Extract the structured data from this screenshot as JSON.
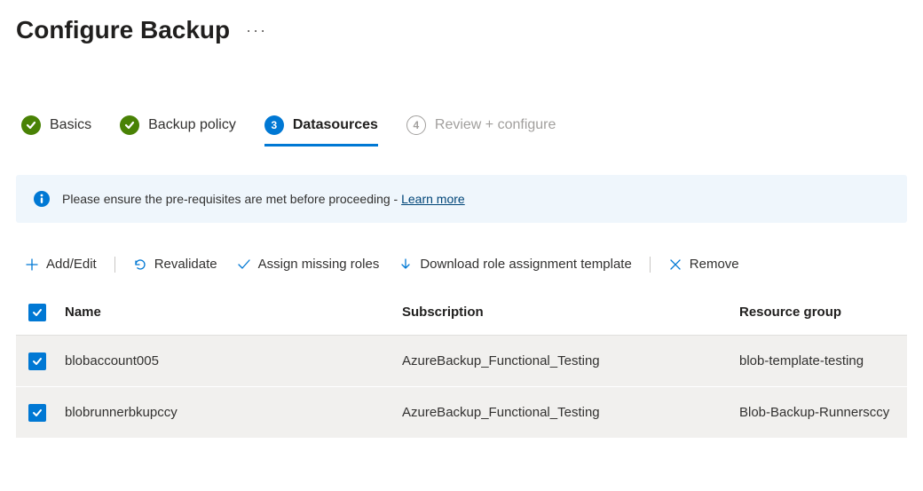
{
  "header": {
    "title": "Configure Backup"
  },
  "steps": [
    {
      "label": "Basics",
      "state": "complete"
    },
    {
      "label": "Backup policy",
      "state": "complete"
    },
    {
      "label": "Datasources",
      "state": "current",
      "number": "3"
    },
    {
      "label": "Review + configure",
      "state": "future",
      "number": "4"
    }
  ],
  "info_banner": {
    "text": "Please ensure the pre-requisites are met before proceeding - ",
    "link_text": "Learn more"
  },
  "toolbar": {
    "add_edit": "Add/Edit",
    "revalidate": "Revalidate",
    "assign_roles": "Assign missing roles",
    "download_template": "Download role assignment template",
    "remove": "Remove"
  },
  "table": {
    "columns": {
      "name": "Name",
      "subscription": "Subscription",
      "resource_group": "Resource group"
    },
    "rows": [
      {
        "checked": true,
        "name": "blobaccount005",
        "subscription": "AzureBackup_Functional_Testing",
        "resource_group": "blob-template-testing"
      },
      {
        "checked": true,
        "name": "blobrunnerbkupccy",
        "subscription": "AzureBackup_Functional_Testing",
        "resource_group": "Blob-Backup-Runnersccy"
      }
    ]
  }
}
